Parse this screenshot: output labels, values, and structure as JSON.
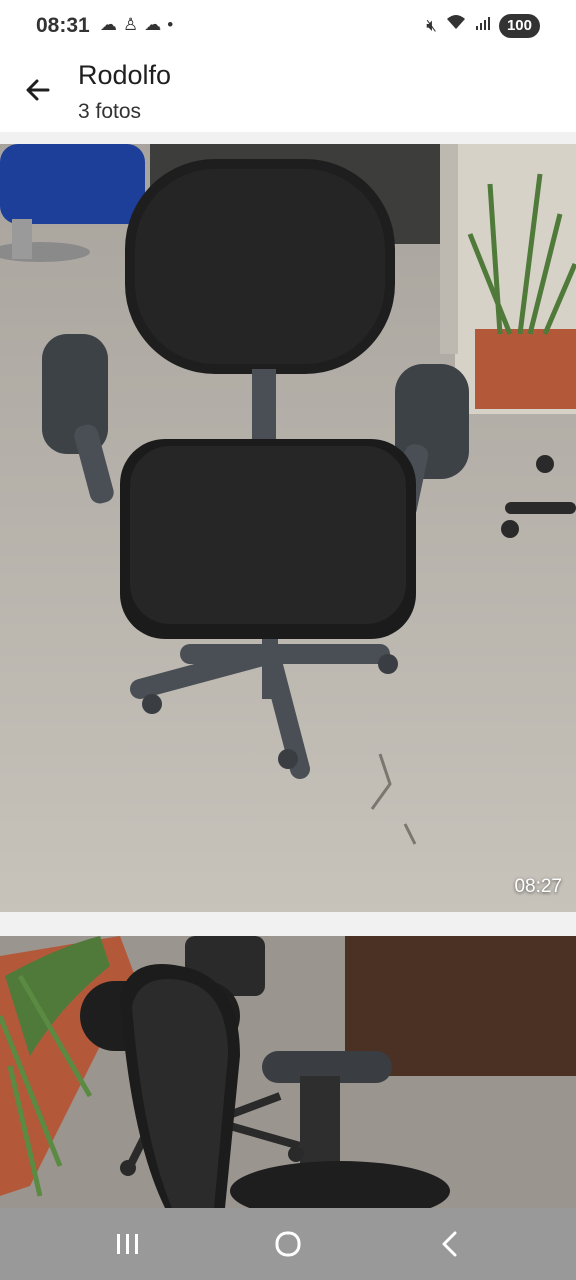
{
  "status": {
    "time": "08:31",
    "icons_left": [
      "cloud-sun-icon",
      "person-icon",
      "cloud-icon",
      "dot-icon"
    ],
    "icons_right": [
      "mute-icon",
      "wifi-icon",
      "signal-icon"
    ],
    "battery": "100"
  },
  "header": {
    "title": "Rodolfo",
    "subtitle": "3 fotos"
  },
  "photos": [
    {
      "subject": "black office chair with armrests",
      "timestamp": "08:27"
    },
    {
      "subject": "black mesh office chair"
    }
  ],
  "nav": {
    "buttons": [
      "recents-icon",
      "home-icon",
      "back-nav-icon"
    ]
  },
  "colors": {
    "background": "#ffffff",
    "divider": "#f1f1f1",
    "nav_bar": "#999999"
  }
}
